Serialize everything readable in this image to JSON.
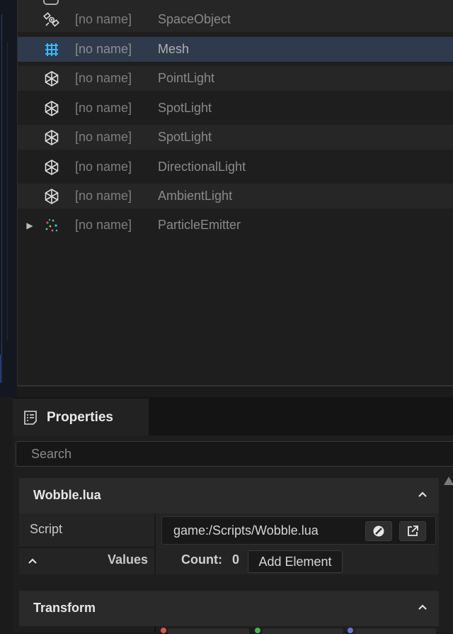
{
  "scene_tree": {
    "rows": [
      {
        "name": "[no name]",
        "type": "SpaceObject",
        "icon": "satellite-icon",
        "selected": false
      },
      {
        "name": "[no name]",
        "type": "Mesh",
        "icon": "mesh-icon",
        "selected": true
      },
      {
        "name": "[no name]",
        "type": "PointLight",
        "icon": "light-node-icon",
        "selected": false
      },
      {
        "name": "[no name]",
        "type": "SpotLight",
        "icon": "light-node-icon",
        "selected": false
      },
      {
        "name": "[no name]",
        "type": "SpotLight",
        "icon": "light-node-icon",
        "selected": false
      },
      {
        "name": "[no name]",
        "type": "DirectionalLight",
        "icon": "light-node-icon",
        "selected": false
      },
      {
        "name": "[no name]",
        "type": "AmbientLight",
        "icon": "light-node-icon",
        "selected": false
      },
      {
        "name": "[no name]",
        "type": "ParticleEmitter",
        "icon": "particle-emitter-icon",
        "selected": false,
        "expandable": true
      }
    ]
  },
  "properties": {
    "tab_label": "Properties",
    "search_placeholder": "Search",
    "script_component": {
      "title": "Wobble.lua",
      "script_label": "Script",
      "script_path": "game:/Scripts/Wobble.lua",
      "values_label": "Values",
      "count_label": "Count:",
      "count_value": "0",
      "add_element_label": "Add Element"
    },
    "transform_component": {
      "title": "Transform"
    }
  },
  "colors": {
    "panel_bg": "#1e1e1e",
    "row_alt": "#262626",
    "row_selected": "#2f3b4c",
    "header_bg": "#2a2a2a",
    "axis_x": "#d9534f",
    "axis_y": "#4caf50",
    "axis_z": "#5b7bd9"
  }
}
